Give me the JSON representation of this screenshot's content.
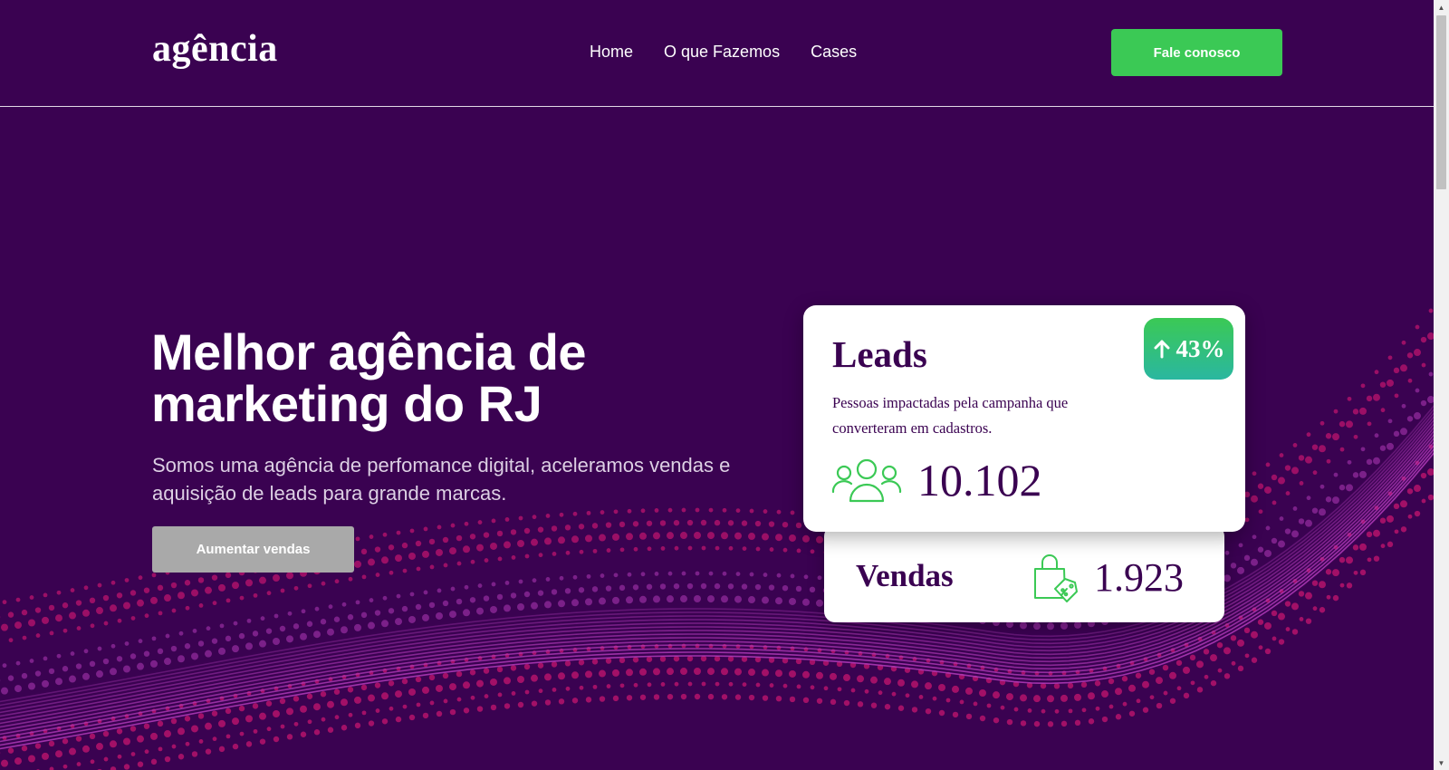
{
  "colors": {
    "background": "#3a0251",
    "accent_green": "#3bc955",
    "card_text": "#3a0251",
    "wave_magenta": "#b03ab8",
    "dot_pink": "#c5156f",
    "secondary_button": "#a9a9a9"
  },
  "header": {
    "logo": "agência",
    "nav": [
      {
        "label": "Home"
      },
      {
        "label": "O que Fazemos"
      },
      {
        "label": "Cases"
      }
    ],
    "cta_label": "Fale conosco"
  },
  "hero": {
    "title": "Melhor agência de marketing do RJ",
    "subtitle": "Somos uma agência de perfomance digital, aceleramos vendas e aquisição de leads para grande marcas.",
    "button_label": "Aumentar vendas"
  },
  "leads_card": {
    "title": "Leads",
    "description": "Pessoas impactadas pela campanha que converteram em cadastros.",
    "value": "10.102",
    "icon": "users-group-icon",
    "growth": {
      "icon": "arrow-up-icon",
      "value": "43%"
    }
  },
  "sales_card": {
    "title": "Vendas",
    "value": "1.923",
    "icon": "shopping-bag-discount-icon"
  },
  "scrollbar": {
    "up_icon": "scroll-up-arrow-icon",
    "down_icon": "scroll-down-arrow-icon"
  }
}
